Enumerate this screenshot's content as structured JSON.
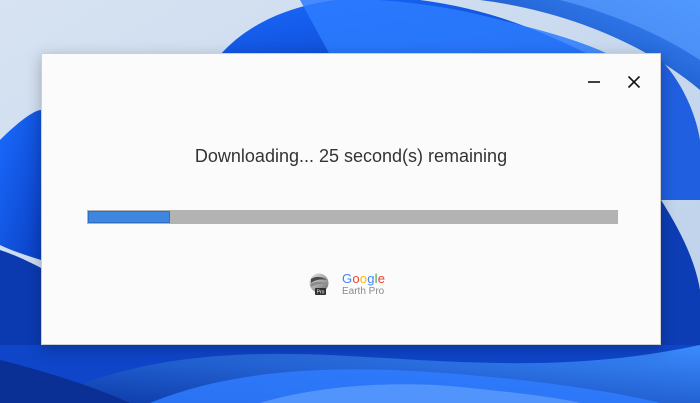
{
  "window": {
    "minimize_icon": "minimize-icon",
    "close_icon": "close-icon"
  },
  "status": {
    "text": "Downloading... 25 second(s) remaining"
  },
  "progress": {
    "percent": 15.5,
    "fill_color": "#3f86e0",
    "track_color": "#b3b3b3"
  },
  "branding": {
    "logo_icon": "google-earth-pro-icon",
    "google_letters": [
      {
        "char": "G",
        "color": "#4285f4"
      },
      {
        "char": "o",
        "color": "#ea4335"
      },
      {
        "char": "o",
        "color": "#fbbc05"
      },
      {
        "char": "g",
        "color": "#4285f4"
      },
      {
        "char": "l",
        "color": "#34a853"
      },
      {
        "char": "e",
        "color": "#ea4335"
      }
    ],
    "google_text": "Google",
    "product_name": "Earth Pro"
  }
}
